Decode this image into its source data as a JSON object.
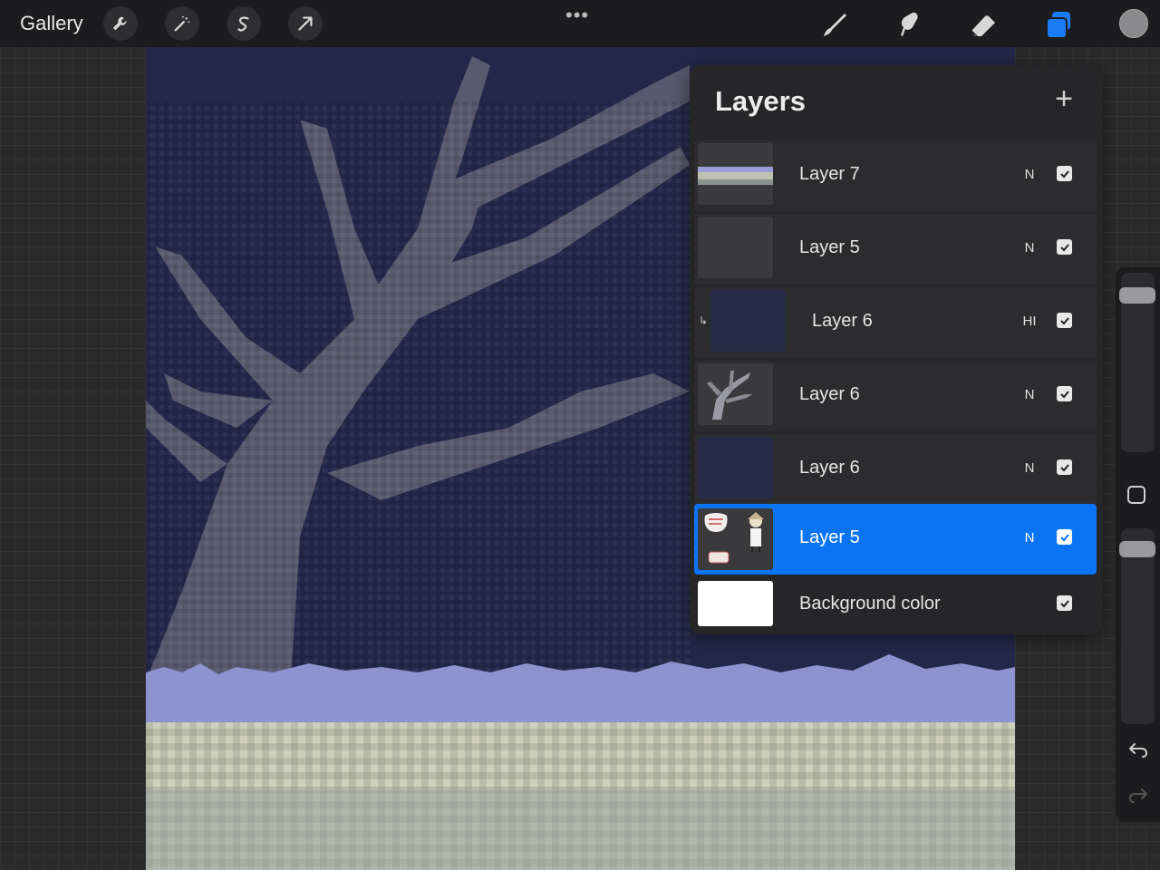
{
  "topbar": {
    "gallery_label": "Gallery",
    "left_tools": [
      {
        "icon": "wrench-icon"
      },
      {
        "icon": "magic-wand-icon"
      },
      {
        "icon": "selection-s-icon"
      },
      {
        "icon": "arrow-transform-icon"
      }
    ],
    "more_label": "•••",
    "right_tools": [
      {
        "icon": "brush-icon"
      },
      {
        "icon": "smudge-icon"
      },
      {
        "icon": "eraser-icon"
      },
      {
        "icon": "layers-icon",
        "active_color": "#1a7cf5"
      }
    ],
    "current_color": "#8a8a8c"
  },
  "layers": {
    "title": "Layers",
    "add_label": "+",
    "items": [
      {
        "name": "Layer 7",
        "blend": "N",
        "visible": true,
        "selected": false,
        "thumb": "horizon"
      },
      {
        "name": "Layer 5",
        "blend": "N",
        "visible": true,
        "selected": false,
        "thumb": "empty"
      },
      {
        "name": "Layer 6",
        "blend": "HI",
        "visible": true,
        "selected": false,
        "thumb": "navy",
        "clipped": true
      },
      {
        "name": "Layer 6",
        "blend": "N",
        "visible": true,
        "selected": false,
        "thumb": "tree"
      },
      {
        "name": "Layer 6",
        "blend": "N",
        "visible": true,
        "selected": false,
        "thumb": "navy"
      },
      {
        "name": "Layer 5",
        "blend": "N",
        "visible": true,
        "selected": true,
        "thumb": "characters"
      },
      {
        "name": "Background color",
        "blend": "",
        "visible": true,
        "selected": false,
        "thumb": "white"
      }
    ]
  },
  "sidebar": {
    "brush_size": 0.88,
    "opacity": 0.9,
    "undo_icon": "undo-icon",
    "redo_icon": "redo-icon"
  },
  "colors": {
    "accent": "#0a74f5",
    "sky": "#23284a",
    "grass_blue": "#8e93cf",
    "grass_light": "#c4c6b0"
  }
}
